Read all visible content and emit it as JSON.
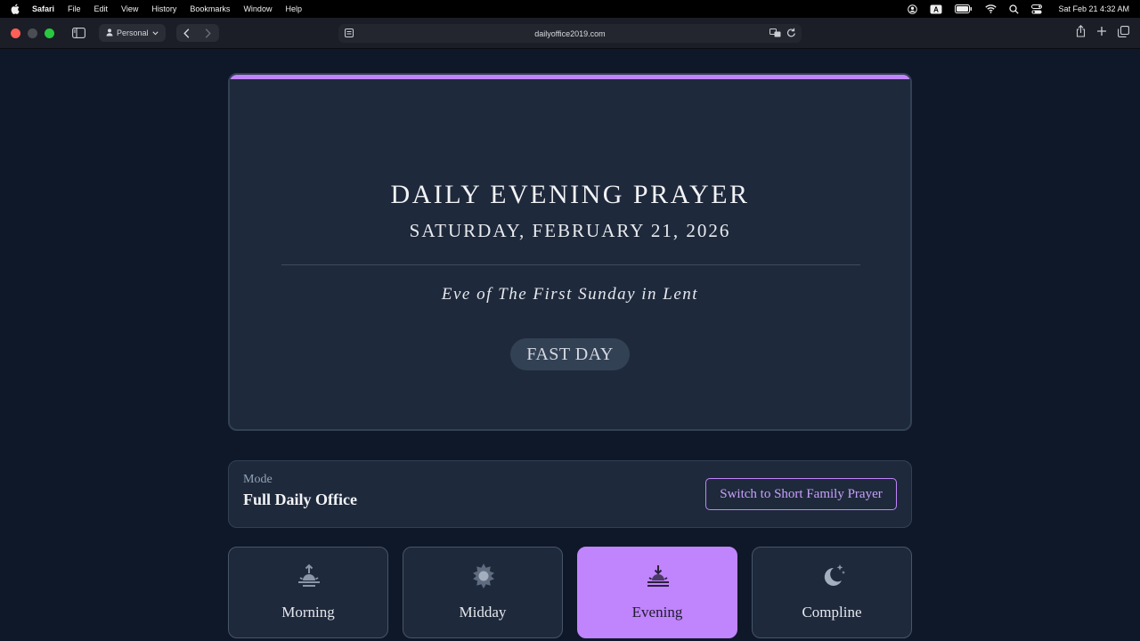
{
  "menubar": {
    "app": "Safari",
    "items": [
      "File",
      "Edit",
      "View",
      "History",
      "Bookmarks",
      "Window",
      "Help"
    ],
    "clock": "Sat Feb 21  4:32 AM"
  },
  "browser": {
    "profile": "Personal",
    "url": "dailyoffice2019.com"
  },
  "hero": {
    "title": "DAILY EVENING PRAYER",
    "date": "SATURDAY, FEBRUARY 21, 2026",
    "observance": "Eve of The First Sunday in Lent",
    "badge": "FAST DAY",
    "accent": "#c084fc"
  },
  "mode": {
    "label": "Mode",
    "value": "Full Daily Office",
    "switch_label": "Switch to Short Family Prayer"
  },
  "offices": [
    {
      "label": "Morning",
      "icon": "sunrise-icon",
      "active": false
    },
    {
      "label": "Midday",
      "icon": "sun-icon",
      "active": false
    },
    {
      "label": "Evening",
      "icon": "sunset-icon",
      "active": true
    },
    {
      "label": "Compline",
      "icon": "moon-stars-icon",
      "active": false
    }
  ]
}
